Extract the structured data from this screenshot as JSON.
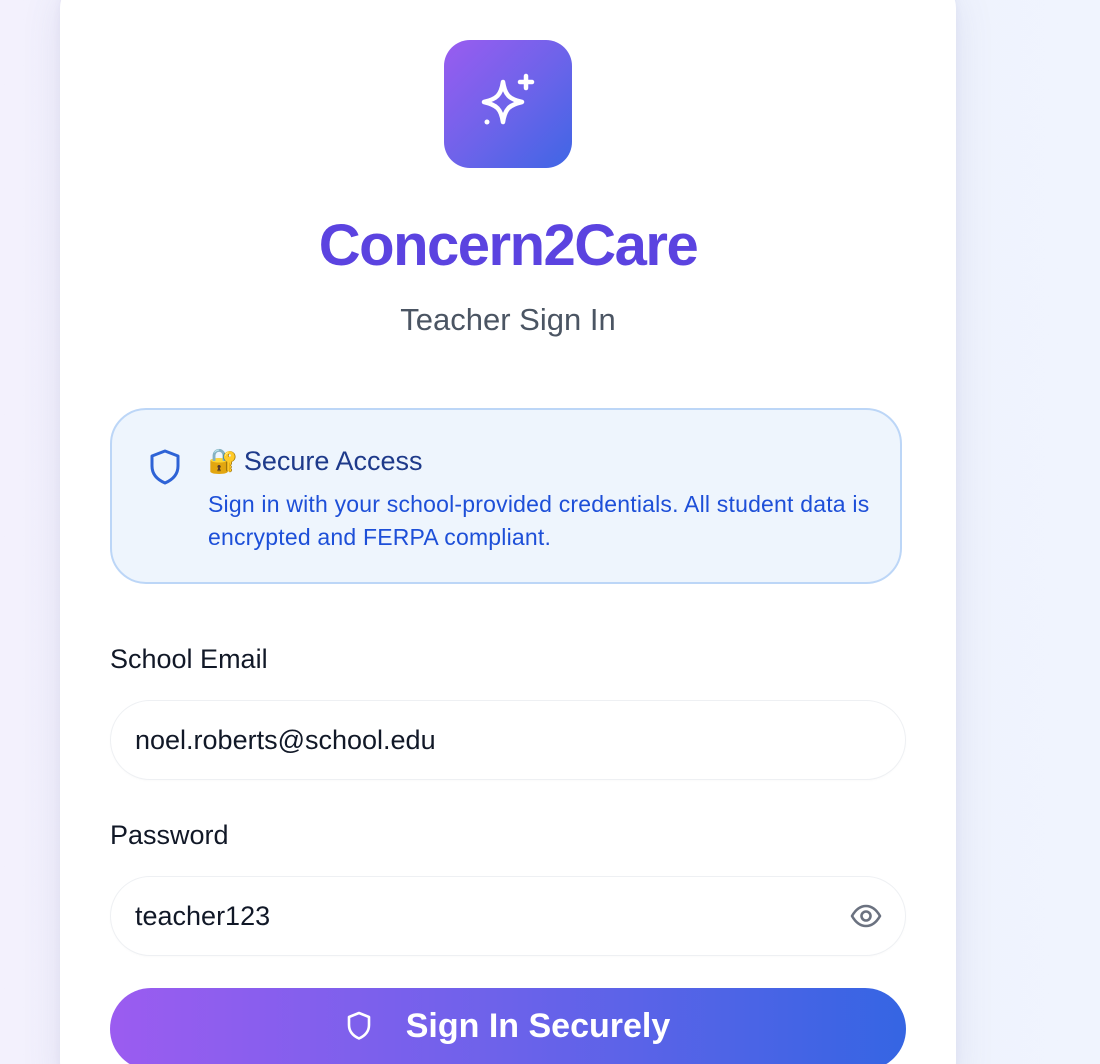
{
  "brand": {
    "name": "Concern2Care",
    "logo_icon": "sparkles-icon",
    "color": "#5b43e0"
  },
  "subtitle": "Teacher Sign In",
  "notice": {
    "icon": "shield-icon",
    "emoji": "🔐",
    "title": "Secure Access",
    "text": "Sign in with your school-provided credentials. All student data is encrypted and FERPA compliant."
  },
  "form": {
    "email_label": "School Email",
    "email_value": "noel.roberts@school.edu",
    "password_label": "Password",
    "password_value": "teacher123",
    "toggle_icon": "eye-icon",
    "submit_label": "Sign In Securely",
    "submit_icon": "shield-icon"
  },
  "colors": {
    "gradient_start": "#9b5cf0",
    "gradient_end": "#3565e3"
  }
}
